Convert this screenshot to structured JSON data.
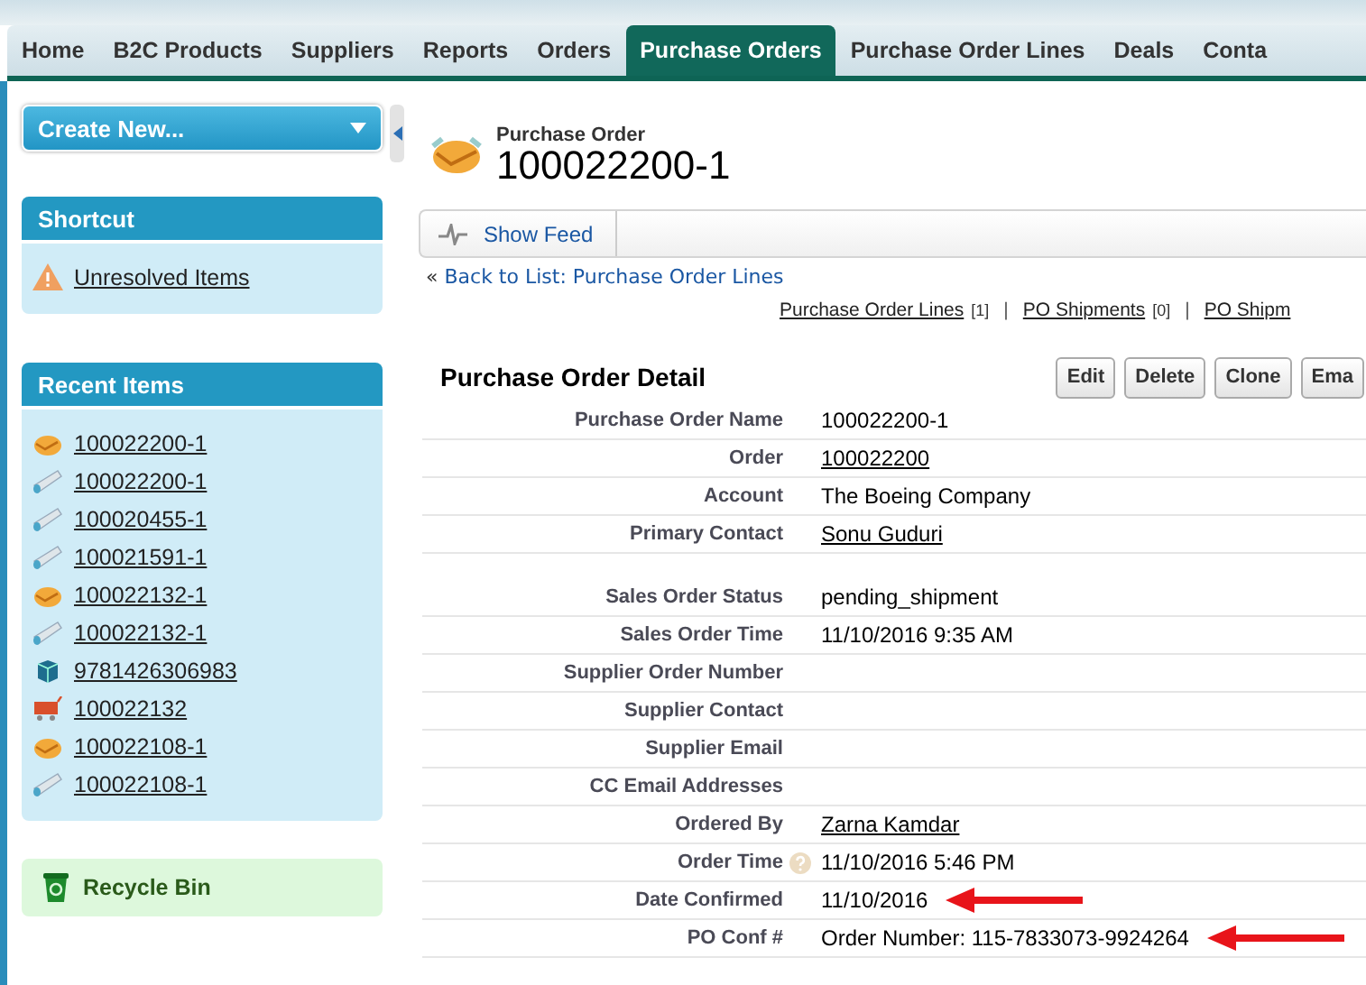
{
  "tabs": [
    {
      "label": "Home",
      "selected": false
    },
    {
      "label": "B2C Products",
      "selected": false
    },
    {
      "label": "Suppliers",
      "selected": false
    },
    {
      "label": "Reports",
      "selected": false
    },
    {
      "label": "Orders",
      "selected": false
    },
    {
      "label": "Purchase Orders",
      "selected": true
    },
    {
      "label": "Purchase Order Lines",
      "selected": false
    },
    {
      "label": "Deals",
      "selected": false
    },
    {
      "label": "Conta",
      "selected": false
    }
  ],
  "sidebar": {
    "create_button": "Create New...",
    "shortcut": {
      "title": "Shortcut",
      "items": [
        {
          "label": "Unresolved Items",
          "kind": "warning"
        }
      ]
    },
    "recent": {
      "title": "Recent Items",
      "items": [
        {
          "label": "100022200-1",
          "kind": "handshake"
        },
        {
          "label": "100022200-1",
          "kind": "tube"
        },
        {
          "label": "100020455-1",
          "kind": "tube"
        },
        {
          "label": "100021591-1",
          "kind": "tube"
        },
        {
          "label": "100022132-1",
          "kind": "handshake"
        },
        {
          "label": "100022132-1",
          "kind": "tube"
        },
        {
          "label": "9781426306983",
          "kind": "box"
        },
        {
          "label": "100022132",
          "kind": "cart"
        },
        {
          "label": "100022108-1",
          "kind": "handshake"
        },
        {
          "label": "100022108-1",
          "kind": "tube"
        }
      ]
    },
    "recycle_bin": "Recycle Bin"
  },
  "record": {
    "type": "Purchase Order",
    "name": "100022200-1"
  },
  "feed_button": "Show Feed",
  "back_link": {
    "prefix": "«",
    "label": "Back to List: Purchase Order Lines"
  },
  "related_links": {
    "separator": "|",
    "items": [
      {
        "label": "Purchase Order Lines",
        "count": "[1]"
      },
      {
        "label": "PO Shipments",
        "count": "[0]"
      },
      {
        "label": "PO Shipm"
      }
    ]
  },
  "detail": {
    "title": "Purchase Order Detail",
    "buttons": [
      "Edit",
      "Delete",
      "Clone",
      "Ema"
    ],
    "sections": [
      [
        {
          "label": "Purchase Order Name",
          "value": "100022200-1",
          "link": false,
          "help": false,
          "arrow": false
        },
        {
          "label": "Order",
          "value": "100022200",
          "link": true,
          "help": false,
          "arrow": false
        },
        {
          "label": "Account",
          "value": "The Boeing Company",
          "link": false,
          "help": false,
          "arrow": false
        },
        {
          "label": "Primary Contact",
          "value": "Sonu Guduri",
          "link": true,
          "help": false,
          "arrow": false
        }
      ],
      [
        {
          "label": "Sales Order Status",
          "value": "pending_shipment",
          "link": false,
          "help": false,
          "arrow": false
        },
        {
          "label": "Sales Order Time",
          "value": "11/10/2016 9:35 AM",
          "link": false,
          "help": false,
          "arrow": false
        },
        {
          "label": "Supplier Order Number",
          "help": false,
          "arrow": false
        },
        {
          "label": "Supplier Contact",
          "help": false,
          "arrow": false
        },
        {
          "label": "Supplier Email",
          "help": false,
          "arrow": false
        },
        {
          "label": "CC Email Addresses",
          "help": false,
          "arrow": false
        },
        {
          "label": "Ordered By",
          "value": "Zarna Kamdar",
          "link": true,
          "help": false,
          "arrow": false
        },
        {
          "label": "Order Time",
          "value": "11/10/2016 5:46 PM",
          "link": false,
          "help": true,
          "arrow": false
        },
        {
          "label": "Date Confirmed",
          "value": "11/10/2016",
          "link": false,
          "help": false,
          "arrow": true
        },
        {
          "label": "PO Conf #",
          "value": "Order Number: 115-7833073-9924264",
          "link": false,
          "help": false,
          "arrow": true
        }
      ]
    ]
  }
}
